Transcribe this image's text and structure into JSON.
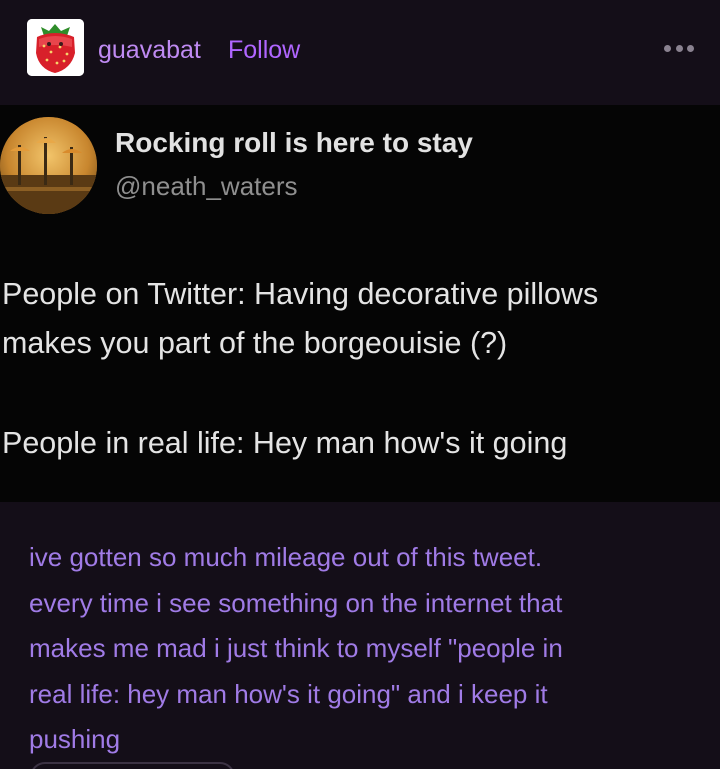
{
  "post": {
    "username": "guavabat",
    "follow_label": "Follow"
  },
  "tweet": {
    "display_name": "Rocking roll is here to stay",
    "handle": "@neath_waters",
    "lines": [
      "People on Twitter: Having decorative pillows",
      "makes you part of the borgeouisie (?)",
      "People in real life: Hey man how's it going"
    ]
  },
  "caption": {
    "lines": [
      "ive gotten so much mileage out of this tweet.",
      "every time i see something on the internet that",
      "makes me mad i just think to myself \"people in",
      "real life: hey man how's it going\" and i keep it",
      "pushing"
    ]
  },
  "icons": {
    "avatar": "strawberry-avatar-icon",
    "more": "more-options-icon",
    "tweet_avatar": "autumn-scene-avatar-icon"
  },
  "colors": {
    "background": "#140e18",
    "tweet_background": "#050505",
    "username": "#bf8af2",
    "follow": "#b066ff",
    "caption": "#a07be6"
  }
}
